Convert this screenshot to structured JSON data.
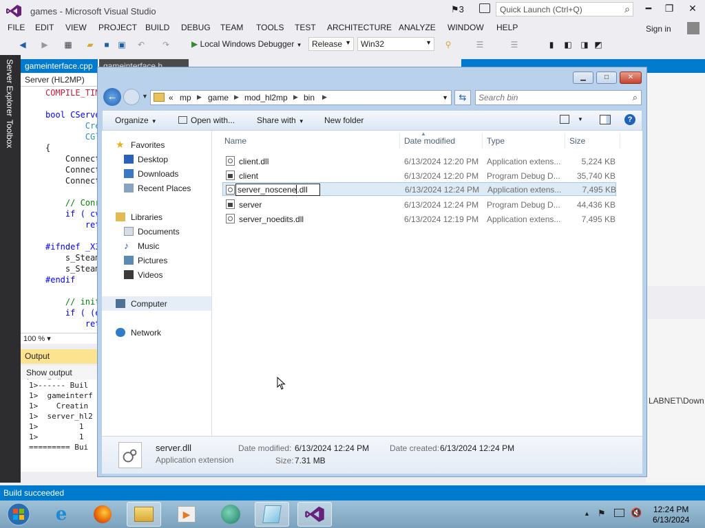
{
  "vs": {
    "title": "games - Microsoft Visual Studio",
    "notifications": "3",
    "quick_launch_placeholder": "Quick Launch (Ctrl+Q)",
    "menu": [
      "FILE",
      "EDIT",
      "VIEW",
      "PROJECT",
      "BUILD",
      "DEBUG",
      "TEAM",
      "TOOLS",
      "TEST",
      "ARCHITECTURE",
      "ANALYZE",
      "WINDOW",
      "HELP"
    ],
    "sign_in": "Sign in",
    "toolbar": {
      "debugger": "Local Windows Debugger",
      "config": "Release",
      "platform": "Win32"
    },
    "side_tabs": [
      "Server Explorer",
      "Toolbox"
    ],
    "editor": {
      "tab_active": "gameinterface.cpp",
      "tab_other": "gameinterface.h",
      "scope": "Server (HL2MP)",
      "zoom": "100 %",
      "lines": [
        "COMPILE_TIM",
        "",
        "bool CServe",
        "        Cre",
        "        CGl",
        "{",
        "    Connect",
        "    Connect",
        "    Connect",
        "",
        "    // Conr",
        "    if ( cv",
        "        ret",
        "",
        "#ifndef _X3",
        "    s_Steam",
        "    s_Steam",
        "#endif",
        "",
        "    // init",
        "    if ( (e",
        "        ret"
      ]
    },
    "output": {
      "title": "Output",
      "source": "Show output from: Buil",
      "lines": [
        "1>------ Buil",
        "1>  gameinterf",
        "1>    Creatin",
        "1>  server_hl2",
        "1>         1",
        "1>         1",
        "========= Bui"
      ]
    },
    "right_path": "LABNET\\Down",
    "status": "Build succeeded"
  },
  "explorer": {
    "breadcrumb": [
      "mp",
      "game",
      "mod_hl2mp",
      "bin"
    ],
    "search_placeholder": "Search bin",
    "commands": {
      "organize": "Organize",
      "open_with": "Open with...",
      "share_with": "Share with",
      "new_folder": "New folder"
    },
    "nav": {
      "favorites": "Favorites",
      "desktop": "Desktop",
      "downloads": "Downloads",
      "recent": "Recent Places",
      "libraries": "Libraries",
      "documents": "Documents",
      "music": "Music",
      "pictures": "Pictures",
      "videos": "Videos",
      "computer": "Computer",
      "network": "Network"
    },
    "columns": {
      "name": "Name",
      "date": "Date modified",
      "type": "Type",
      "size": "Size"
    },
    "files": [
      {
        "name": "client.dll",
        "date": "6/13/2024 12:20 PM",
        "type": "Application extens...",
        "size": "5,224 KB"
      },
      {
        "name": "client",
        "date": "6/13/2024 12:20 PM",
        "type": "Program Debug D...",
        "size": "35,740 KB"
      },
      {
        "name": "server_noscene.dll",
        "date": "6/13/2024 12:24 PM",
        "type": "Application extens...",
        "size": "7,495 KB"
      },
      {
        "name": "server",
        "date": "6/13/2024 12:24 PM",
        "type": "Program Debug D...",
        "size": "44,436 KB"
      },
      {
        "name": "server_noedits.dll",
        "date": "6/13/2024 12:19 PM",
        "type": "Application extens...",
        "size": "7,495 KB"
      }
    ],
    "rename": {
      "selected": "server_noscene",
      "rest": ".dll"
    },
    "details": {
      "name": "server.dll",
      "type": "Application extension",
      "date_modified_label": "Date modified:",
      "date_modified": "6/13/2024 12:24 PM",
      "date_created_label": "Date created:",
      "date_created": "6/13/2024 12:24 PM",
      "size_label": "Size:",
      "size": "7.31 MB"
    }
  },
  "taskbar": {
    "time": "12:24 PM",
    "date": "6/13/2024"
  },
  "colors": {
    "vs_accent": "#007acc",
    "vs_purple": "#68217a",
    "output_header": "#fbe38f"
  }
}
